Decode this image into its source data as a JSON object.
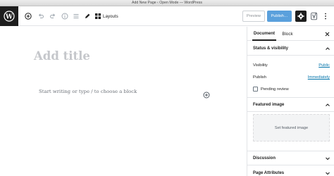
{
  "window": {
    "title": "Add New Page ‹ Open Mode — WordPress"
  },
  "toolbar": {
    "layouts_label": "Layouts",
    "preview_label": "Preview",
    "publish_label": "Publish…"
  },
  "editor": {
    "title_placeholder": "Add title",
    "body_placeholder": "Start writing or type / to choose a block"
  },
  "sidebar": {
    "tabs": [
      {
        "label": "Document",
        "active": true
      },
      {
        "label": "Block",
        "active": false
      }
    ],
    "status": {
      "heading": "Status & visibility",
      "visibility_label": "Visibility",
      "visibility_value": "Public",
      "publish_label": "Publish",
      "publish_value": "Immediately",
      "pending_label": "Pending review"
    },
    "featured": {
      "heading": "Featured image",
      "button": "Set featured image"
    },
    "discussion": {
      "heading": "Discussion"
    },
    "attributes": {
      "heading": "Page Attributes"
    }
  },
  "colors": {
    "accent": "#5aa0dc",
    "link": "#0073aa",
    "dark": "#1e1e1e"
  }
}
